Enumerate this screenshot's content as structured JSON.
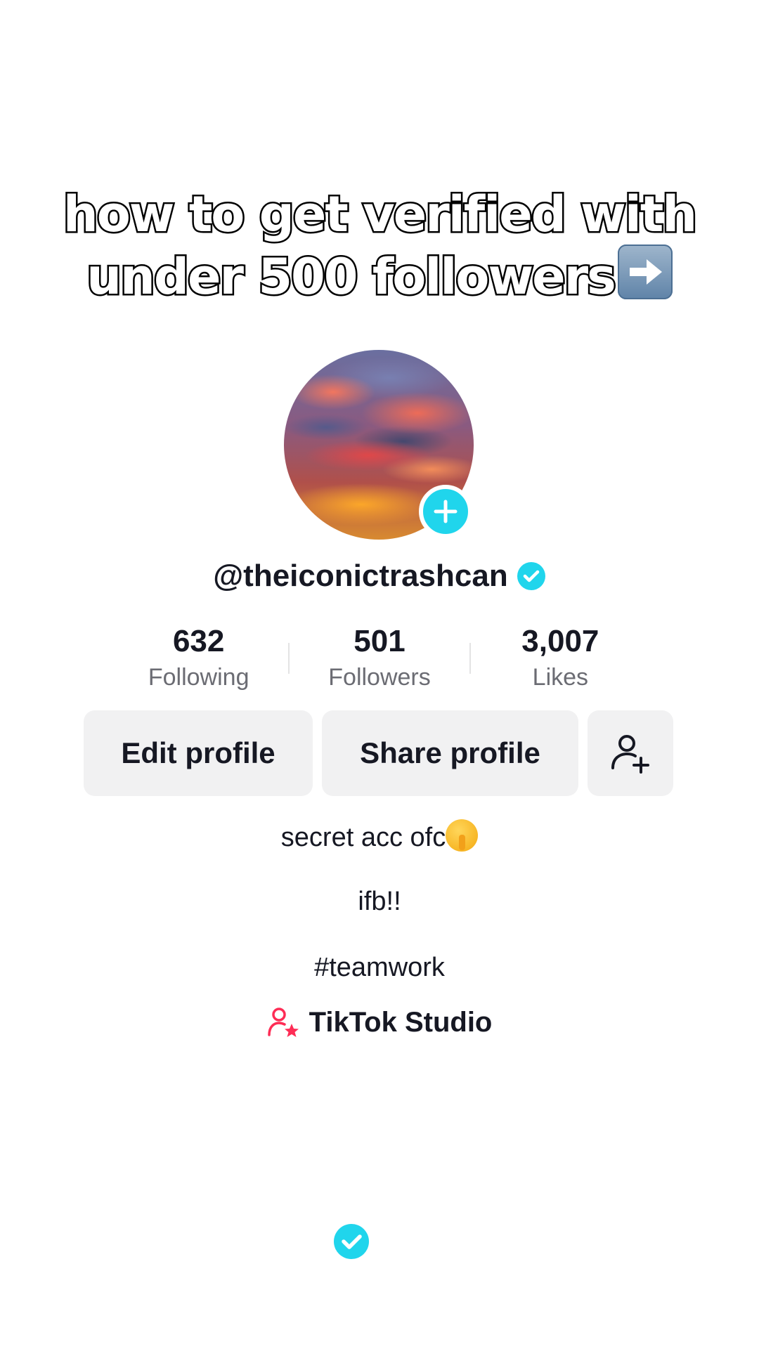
{
  "caption": {
    "line1": "how to get verified with",
    "line2": "under 500 followers",
    "emoji": "right-arrow-icon"
  },
  "profile": {
    "username": "@theiconictrashcan",
    "verified_icon": "verified-badge-icon",
    "avatar_add_icon": "plus-icon"
  },
  "stats": [
    {
      "value": "632",
      "label": "Following"
    },
    {
      "value": "501",
      "label": "Followers"
    },
    {
      "value": "3,007",
      "label": "Likes"
    }
  ],
  "buttons": {
    "edit_profile": "Edit profile",
    "share_profile": "Share profile",
    "add_friend_icon": "add-user-icon"
  },
  "bio": {
    "line1": "secret acc ofc",
    "line1_emoji": "shushing-face-emoji",
    "line2": "ifb!!",
    "line3": "#teamwork"
  },
  "studio": {
    "label": "TikTok Studio",
    "icon": "creator-star-icon"
  },
  "colors": {
    "accent": "#20d5ec",
    "studio_pink": "#fe2c55",
    "button_bg": "#f1f1f2",
    "text_primary": "#161823",
    "text_secondary": "#6b6c73"
  }
}
